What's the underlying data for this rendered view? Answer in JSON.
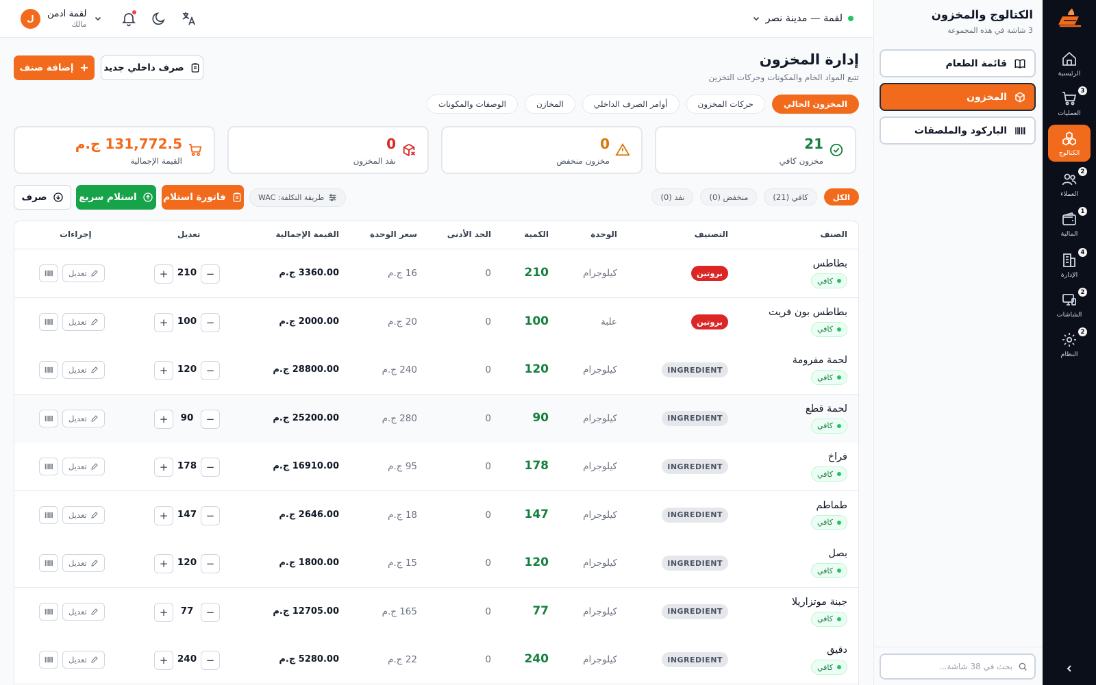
{
  "rail": {
    "items": [
      {
        "label": "الرئيسية",
        "icon": "home-icon",
        "badge": ""
      },
      {
        "label": "العمليات",
        "icon": "cart-icon",
        "badge": "3"
      },
      {
        "label": "الكتالوج",
        "icon": "catalog-icon",
        "badge": ""
      },
      {
        "label": "العملاء",
        "icon": "users-icon",
        "badge": "2"
      },
      {
        "label": "المالية",
        "icon": "wallet-icon",
        "badge": "1"
      },
      {
        "label": "الإدارة",
        "icon": "building-icon",
        "badge": "4"
      },
      {
        "label": "الشاشات",
        "icon": "monitor-icon",
        "badge": "2"
      },
      {
        "label": "النظام",
        "icon": "gear-icon",
        "badge": "2"
      }
    ],
    "active": "الكتالوج"
  },
  "sidebar": {
    "title": "الكتالوج والمخزون",
    "subtitle": "3 شاشة في هذه المجموعة",
    "items": [
      {
        "label": "قائمة الطعام",
        "icon": "book-icon"
      },
      {
        "label": "المخزون",
        "icon": "box-icon"
      },
      {
        "label": "الباركود والملصقات",
        "icon": "barcode-icon"
      }
    ],
    "search_placeholder": "بحث في 38 شاشة..."
  },
  "topbar": {
    "branch": "لقمة — مدينة نصر",
    "user_name": "لقمة ادمن",
    "user_role": "مالك",
    "avatar_letter": "ل"
  },
  "page": {
    "title": "إدارة المخزون",
    "subtitle": "تتبع المواد الخام والمكونات وحركات التخزين",
    "add_item": "إضافة صنف",
    "new_issue": "صرف داخلي جديد"
  },
  "tabs": [
    "المخزون الحالي",
    "حركات المخزون",
    "أوامر الصرف الداخلي",
    "المخازن",
    "الوصفات والمكونات"
  ],
  "stats": [
    {
      "value": "21",
      "label": "مخزون كافي",
      "color": "#15803d",
      "icon": "check-circle-icon"
    },
    {
      "value": "0",
      "label": "مخزون منخفض",
      "color": "#d97706",
      "icon": "warning-icon"
    },
    {
      "value": "0",
      "label": "نفد المخزون",
      "color": "#dc2626",
      "icon": "box-x-icon"
    },
    {
      "value": "131,772.5 ج.م",
      "label": "القيمة الإجمالية",
      "color": "#f26b1d",
      "icon": "cart-icon"
    }
  ],
  "filters": [
    "الكل",
    "كافي (21)",
    "منخفض (0)",
    "نفد (0)"
  ],
  "toolbar": {
    "cost_method": "طريقة التكلفة: WAC",
    "receipt_invoice": "فاتورة استلام",
    "quick_receive": "استلام سريع",
    "issue": "صرف"
  },
  "table": {
    "headers": [
      "الصنف",
      "التصنيف",
      "الوحدة",
      "الكمية",
      "الحد الأدنى",
      "سعر الوحدة",
      "القيمة الإجمالية",
      "تعديل",
      "إجراءات"
    ],
    "edit_label": "تعديل",
    "rows": [
      {
        "name": "بطاطس",
        "status": "كافي",
        "category": "بروتين",
        "unit": "كيلوجرام",
        "qty": "210",
        "min": "0",
        "price": "16 ج.م",
        "total": "3360.00 ج.م"
      },
      {
        "name": "بطاطس بون فريت",
        "status": "كافي",
        "category": "بروتين",
        "unit": "علبة",
        "qty": "100",
        "min": "0",
        "price": "20 ج.م",
        "total": "2000.00 ج.م"
      },
      {
        "name": "لحمة مفرومة",
        "status": "كافي",
        "category": "INGREDIENT",
        "unit": "كيلوجرام",
        "qty": "120",
        "min": "0",
        "price": "240 ج.م",
        "total": "28800.00 ج.م"
      },
      {
        "name": "لحمة قطع",
        "status": "كافي",
        "category": "INGREDIENT",
        "unit": "كيلوجرام",
        "qty": "90",
        "min": "0",
        "price": "280 ج.م",
        "total": "25200.00 ج.م"
      },
      {
        "name": "فراخ",
        "status": "كافي",
        "category": "INGREDIENT",
        "unit": "كيلوجرام",
        "qty": "178",
        "min": "0",
        "price": "95 ج.م",
        "total": "16910.00 ج.م"
      },
      {
        "name": "طماطم",
        "status": "كافي",
        "category": "INGREDIENT",
        "unit": "كيلوجرام",
        "qty": "147",
        "min": "0",
        "price": "18 ج.م",
        "total": "2646.00 ج.م"
      },
      {
        "name": "بصل",
        "status": "كافي",
        "category": "INGREDIENT",
        "unit": "كيلوجرام",
        "qty": "120",
        "min": "0",
        "price": "15 ج.م",
        "total": "1800.00 ج.م"
      },
      {
        "name": "جبنة موتزاريلا",
        "status": "كافي",
        "category": "INGREDIENT",
        "unit": "كيلوجرام",
        "qty": "77",
        "min": "0",
        "price": "165 ج.م",
        "total": "12705.00 ج.م"
      },
      {
        "name": "دقيق",
        "status": "كافي",
        "category": "INGREDIENT",
        "unit": "كيلوجرام",
        "qty": "240",
        "min": "0",
        "price": "22 ج.م",
        "total": "5280.00 ج.م"
      }
    ]
  },
  "colors": {
    "accent": "#f26b1d",
    "rail_bg": "#0b0f19",
    "success": "#15803d",
    "danger": "#dc2626"
  }
}
